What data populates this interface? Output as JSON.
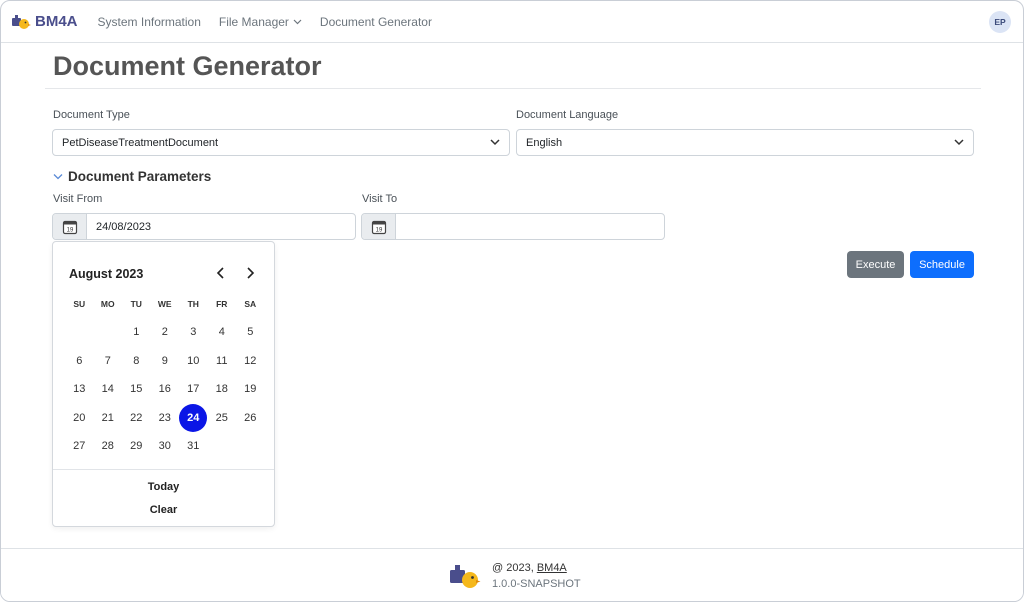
{
  "navbar": {
    "brand": "BM4A",
    "items": [
      {
        "label": "System Information"
      },
      {
        "label": "File Manager"
      },
      {
        "label": "Document Generator"
      }
    ],
    "avatar_initials": "EP"
  },
  "page": {
    "title": "Document Generator"
  },
  "form": {
    "document_type": {
      "label": "Document Type",
      "value": "PetDiseaseTreatmentDocument"
    },
    "document_language": {
      "label": "Document Language",
      "value": "English"
    },
    "parameters_section": "Document Parameters",
    "visit_from": {
      "label": "Visit From",
      "value": "24/08/2023"
    },
    "visit_to": {
      "label": "Visit To",
      "value": ""
    },
    "calendar_icon_text": "19"
  },
  "calendar": {
    "month_title": "August 2023",
    "weekdays": [
      "SU",
      "MO",
      "TU",
      "WE",
      "TH",
      "FR",
      "SA"
    ],
    "weeks": [
      [
        "",
        "",
        "1",
        "2",
        "3",
        "4",
        "5"
      ],
      [
        "6",
        "7",
        "8",
        "9",
        "10",
        "11",
        "12"
      ],
      [
        "13",
        "14",
        "15",
        "16",
        "17",
        "18",
        "19"
      ],
      [
        "20",
        "21",
        "22",
        "23",
        "24",
        "25",
        "26"
      ],
      [
        "27",
        "28",
        "29",
        "30",
        "31",
        "",
        ""
      ]
    ],
    "selected_day": "24",
    "today_label": "Today",
    "clear_label": "Clear"
  },
  "actions": {
    "execute_label": "Execute",
    "schedule_label": "Schedule"
  },
  "footer": {
    "copyright_prefix": "@ 2023, ",
    "copyright_link": "BM4A",
    "version": "1.0.0-SNAPSHOT"
  },
  "colors": {
    "brand": "#4a4e8c",
    "primary": "#0d6efd",
    "secondary": "#6c757d",
    "selected_day": "#0b16e6"
  }
}
